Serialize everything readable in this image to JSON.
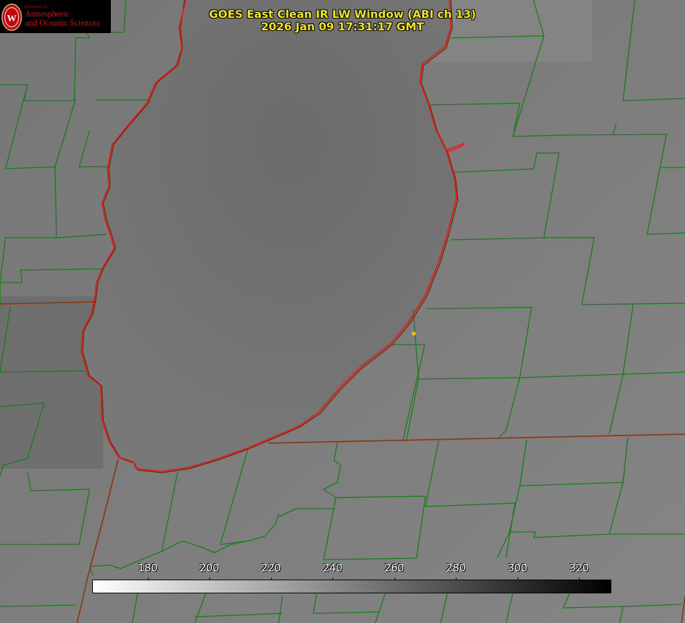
{
  "header": {
    "title_line1": "GOES East Clean IR LW Window (ABI ch 13)",
    "title_line2": "2026 Jan 09 17:31:17 GMT"
  },
  "logo": {
    "dept": "Department of",
    "line1": "Atmospheric",
    "line2": "and Oceanic Sciences",
    "seal_letter": "W"
  },
  "colorbar": {
    "ticks": [
      {
        "label": "180",
        "value": 180
      },
      {
        "label": "200",
        "value": 200
      },
      {
        "label": "220",
        "value": 220
      },
      {
        "label": "240",
        "value": 240
      },
      {
        "label": "260",
        "value": 260
      },
      {
        "label": "280",
        "value": 280
      },
      {
        "label": "300",
        "value": 300
      },
      {
        "label": "320",
        "value": 320
      }
    ],
    "min": 162,
    "max": 330
  },
  "colors": {
    "title": "#f2e600",
    "county_lines": "#108010",
    "state_lines": "#8a3a10",
    "coastline": "#ff1010",
    "point_marker": "#d8c800",
    "logo_red": "#c5050c"
  }
}
